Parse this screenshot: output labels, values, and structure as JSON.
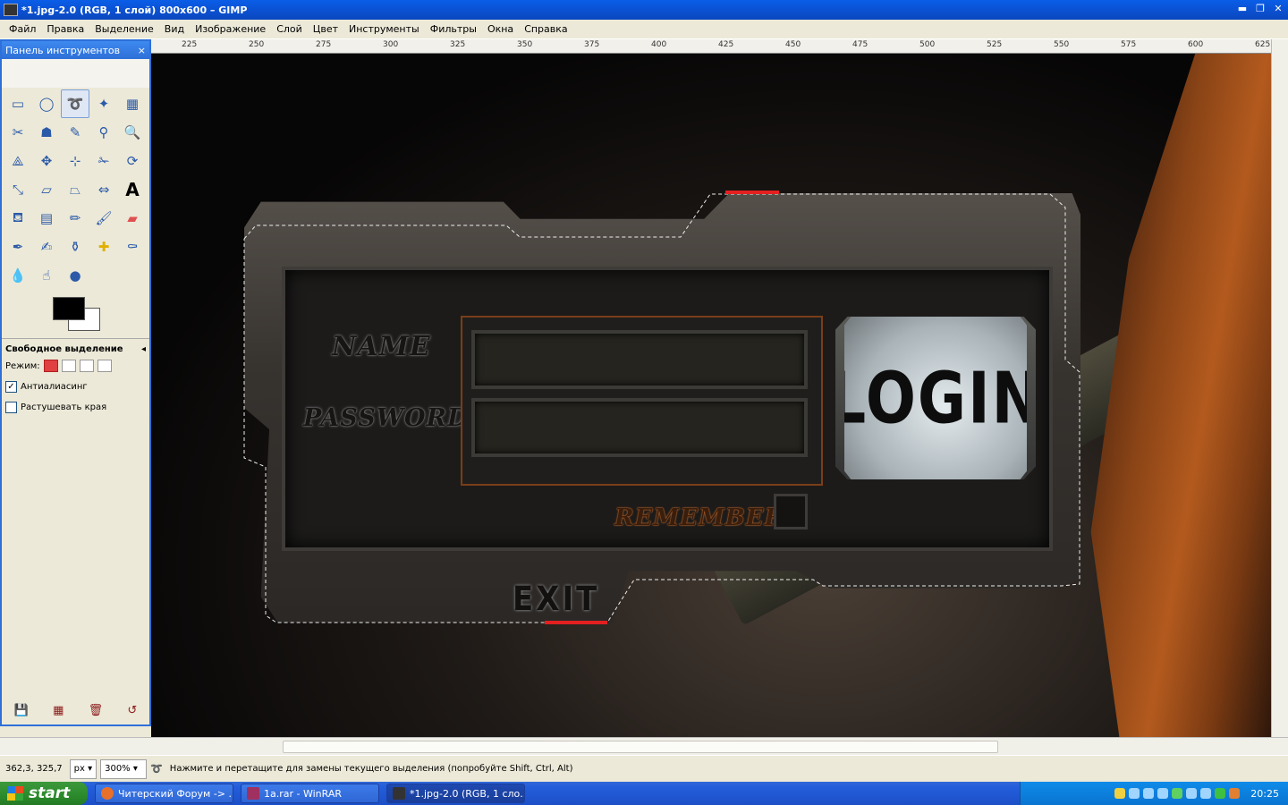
{
  "window": {
    "title": "*1.jpg-2.0 (RGB, 1 слой) 800x600 – GIMP",
    "buttons": {
      "minimize": "▬",
      "maximize": "❐",
      "close": "✕"
    }
  },
  "menu": [
    "Файл",
    "Правка",
    "Выделение",
    "Вид",
    "Изображение",
    "Слой",
    "Цвет",
    "Инструменты",
    "Фильтры",
    "Окна",
    "Справка"
  ],
  "toolbox": {
    "title": "Панель инструментов",
    "close": "×",
    "tools": [
      "rect-select",
      "ellipse-select",
      "free-select",
      "fuzzy-select",
      "color-select",
      "scissors",
      "foreground-select",
      "paths",
      "color-picker",
      "zoom",
      "measure",
      "move",
      "align",
      "crop",
      "rotate",
      "scale",
      "shear",
      "perspective",
      "flip",
      "text",
      "bucket-fill",
      "blend",
      "pencil",
      "paintbrush",
      "eraser",
      "airbrush",
      "ink",
      "clone",
      "heal",
      "perspective-clone",
      "blur",
      "smudge",
      "dodge-burn"
    ],
    "options": {
      "title": "Свободное выделение",
      "mode_label": "Режим:",
      "antialias": "Антиалиасинг",
      "feather": "Растушевать края"
    }
  },
  "ruler": [
    "225",
    "250",
    "275",
    "300",
    "325",
    "350",
    "375",
    "400",
    "425",
    "450",
    "475",
    "500",
    "525",
    "550",
    "575",
    "600",
    "625"
  ],
  "image": {
    "labels": {
      "name": "NAME",
      "password": "PASSWORD",
      "login": "LOGIN",
      "remember": "REMEMBER",
      "exit": "EXIT"
    }
  },
  "status": {
    "coords": "362,3, 325,7",
    "unit": "px",
    "zoom": "300%",
    "message": "Нажмите и перетащите для замены текущего выделения (попробуйте Shift, Ctrl, Alt)"
  },
  "taskbar": {
    "start": "start",
    "tasks": [
      "Читерский Форум -> ...",
      "1a.rar - WinRAR",
      "*1.jpg-2.0 (RGB, 1 сло..."
    ],
    "clock": "20:25"
  },
  "colors": {
    "title_blue": "#0b4fcf",
    "selection_red": "#e32020",
    "taskbar_blue": "#245edb",
    "start_green": "#2b8a2b"
  }
}
